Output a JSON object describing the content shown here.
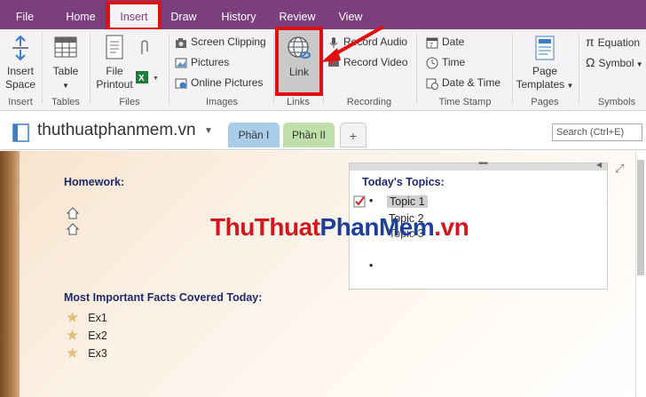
{
  "tabs": [
    "File",
    "Home",
    "Insert",
    "Draw",
    "History",
    "Review",
    "View"
  ],
  "active_tab": "Insert",
  "ribbon": {
    "insert": {
      "label1": "Insert",
      "label2": "Space",
      "group": "Insert"
    },
    "tables": {
      "label": "Table",
      "group": "Tables"
    },
    "files": {
      "label1": "File",
      "label2": "Printout",
      "group": "Files"
    },
    "images": {
      "screen_clipping": "Screen Clipping",
      "pictures": "Pictures",
      "online_pictures": "Online Pictures",
      "group": "Images"
    },
    "links": {
      "label": "Link",
      "group": "Links"
    },
    "recording": {
      "audio": "Record Audio",
      "video": "Record Video",
      "group": "Recording"
    },
    "time_stamp": {
      "date": "Date",
      "time": "Time",
      "date_time": "Date & Time",
      "group": "Time Stamp"
    },
    "pages": {
      "label1": "Page",
      "label2": "Templates",
      "group": "Pages"
    },
    "symbols": {
      "equation": "Equation",
      "symbol": "Symbol",
      "group": "Symbols"
    }
  },
  "notebook": {
    "name": "thuthuatphanmem.vn",
    "sections": [
      "Phần I",
      "Phần II",
      "+"
    ],
    "search_placeholder": "Search (Ctrl+E)"
  },
  "page": {
    "homework": "Homework:",
    "facts_heading": "Most Important Facts Covered Today:",
    "facts": [
      "Ex1",
      "Ex2",
      "Ex3"
    ],
    "topics_heading": "Today's Topics:",
    "topics": [
      "Topic 1",
      "Topic 2",
      "Topic 3"
    ],
    "watermark_a": "ThuThuat",
    "watermark_b": "PhanMem",
    "watermark_c": ".vn"
  },
  "colors": {
    "brand": "#7B3F7E",
    "highlight": "#e01010",
    "heading": "#1f2a6e"
  }
}
